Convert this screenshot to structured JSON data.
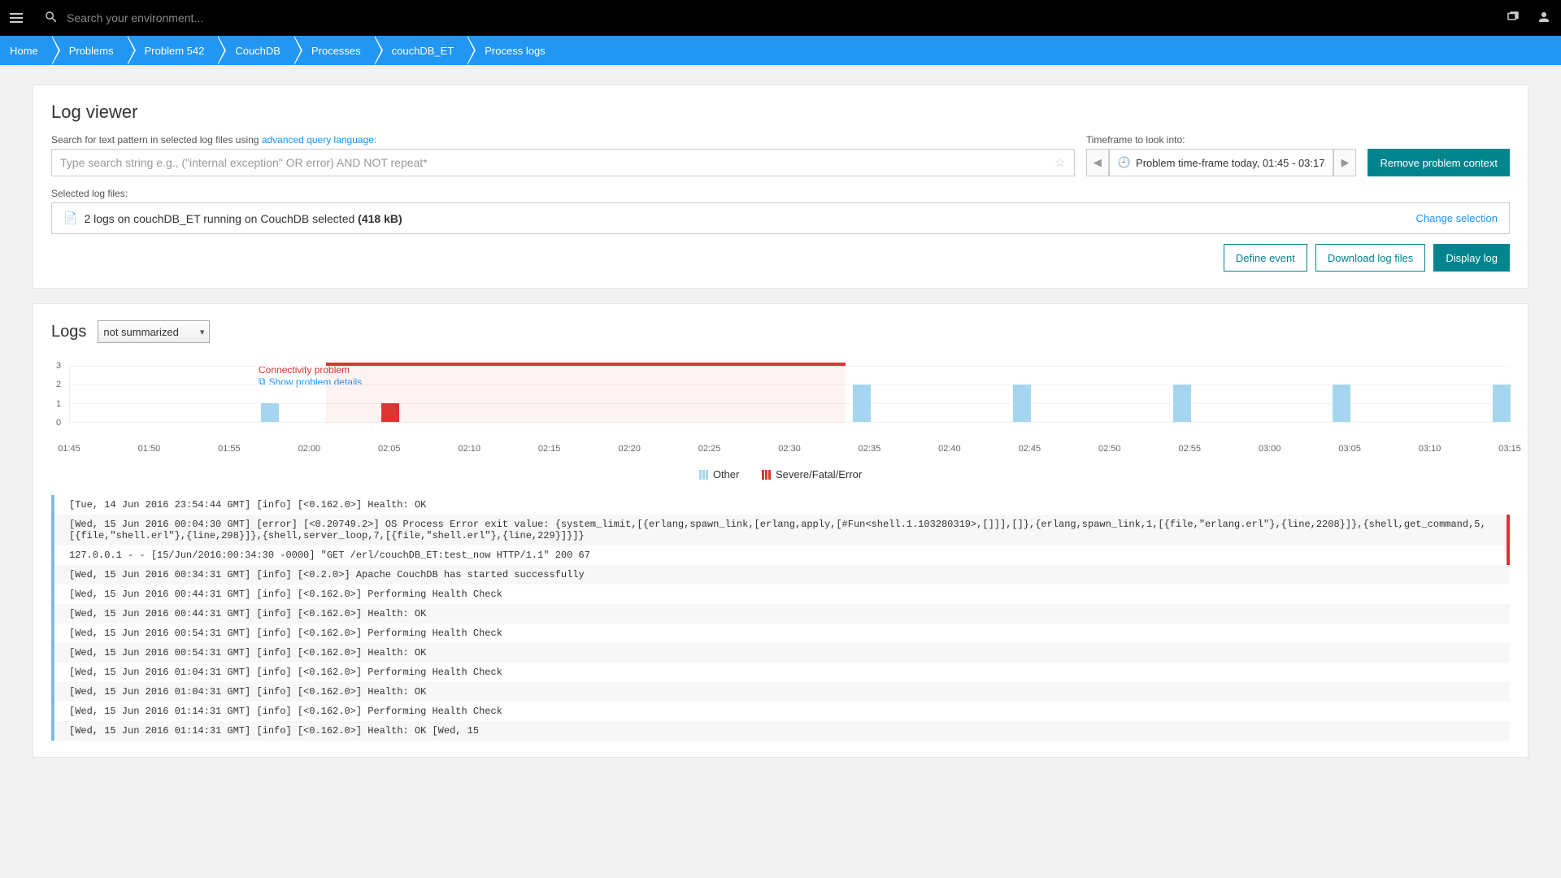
{
  "topbar": {
    "search_placeholder": "Search your environment..."
  },
  "breadcrumb": [
    "Home",
    "Problems",
    "Problem 542",
    "CouchDB",
    "Processes",
    "couchDB_ET",
    "Process logs"
  ],
  "viewer": {
    "title": "Log viewer",
    "search_label_prefix": "Search for text pattern in selected log files using ",
    "search_label_link": "advanced query language:",
    "search_placeholder": "Type search string e.g., (\"internal exception\" OR error) AND NOT repeat*",
    "timeframe_label": "Timeframe to look into:",
    "timeframe_value": "Problem time-frame today, 01:45 - 03:17",
    "remove_context_btn": "Remove problem context",
    "selected_label": "Selected log files:",
    "selected_text": "2 logs on couchDB_ET running on CouchDB selected ",
    "selected_size": "(418 kB)",
    "change_selection": "Change selection",
    "define_event_btn": "Define event",
    "download_btn": "Download log files",
    "display_btn": "Display log"
  },
  "logs": {
    "heading": "Logs",
    "summary_select": "not summarized",
    "problem_title": "Connectivity problem",
    "problem_details_link": "Show problem details",
    "legend_other": "Other",
    "legend_error": "Severe/Fatal/Error"
  },
  "chart_data": {
    "type": "bar",
    "x_ticks": [
      "01:45",
      "01:50",
      "01:55",
      "02:00",
      "02:05",
      "02:10",
      "02:15",
      "02:20",
      "02:25",
      "02:30",
      "02:35",
      "02:40",
      "02:45",
      "02:50",
      "02:55",
      "03:00",
      "03:05",
      "03:10",
      "03:15"
    ],
    "ylim": [
      0,
      3
    ],
    "y_ticks": [
      0,
      1,
      2,
      3
    ],
    "problem_band": {
      "start_index": 3.2,
      "end_index": 9.7
    },
    "series": [
      {
        "name": "Other",
        "class": "other",
        "bars": [
          {
            "x_index": 2.5,
            "value": 1
          },
          {
            "x_index": 9.9,
            "value": 2
          },
          {
            "x_index": 11.9,
            "value": 2
          },
          {
            "x_index": 13.9,
            "value": 2
          },
          {
            "x_index": 15.9,
            "value": 2
          },
          {
            "x_index": 17.9,
            "value": 2
          }
        ]
      },
      {
        "name": "Severe/Fatal/Error",
        "class": "error",
        "bars": [
          {
            "x_index": 4.0,
            "value": 1
          }
        ]
      }
    ]
  },
  "log_lines": [
    "[Tue, 14 Jun 2016 23:54:44 GMT] [info] [<0.162.0>] Health: OK",
    "[Wed, 15 Jun 2016 00:04:30 GMT] [error] [<0.20749.2>] OS Process Error exit value: {system_limit,[{erlang,spawn_link,[erlang,apply,[#Fun<shell.1.103280319>,[]]],[]},{erlang,spawn_link,1,[{file,\"erlang.erl\"},{line,2208}]},{shell,get_command,5,[{file,\"shell.erl\"},{line,298}]},{shell,server_loop,7,[{file,\"shell.erl\"},{line,229}]}]}",
    "127.0.0.1 - - [15/Jun/2016:00:34:30 -0000] \"GET /erl/couchDB_ET:test_now HTTP/1.1\" 200 67",
    "[Wed, 15 Jun 2016 00:34:31 GMT] [info] [<0.2.0>] Apache CouchDB has started successfully",
    "[Wed, 15 Jun 2016 00:44:31 GMT] [info] [<0.162.0>] Performing Health Check",
    "[Wed, 15 Jun 2016 00:44:31 GMT] [info] [<0.162.0>] Health: OK",
    "[Wed, 15 Jun 2016 00:54:31 GMT] [info] [<0.162.0>] Performing Health Check",
    "[Wed, 15 Jun 2016 00:54:31 GMT] [info] [<0.162.0>] Health: OK",
    "[Wed, 15 Jun 2016 01:04:31 GMT] [info] [<0.162.0>] Performing Health Check",
    "[Wed, 15 Jun 2016 01:04:31 GMT] [info] [<0.162.0>] Health: OK",
    "[Wed, 15 Jun 2016 01:14:31 GMT] [info] [<0.162.0>] Performing Health Check",
    "[Wed, 15 Jun 2016 01:14:31 GMT] [info] [<0.162.0>] Health: OK [Wed, 15"
  ],
  "error_line_indices": [
    1,
    2
  ]
}
